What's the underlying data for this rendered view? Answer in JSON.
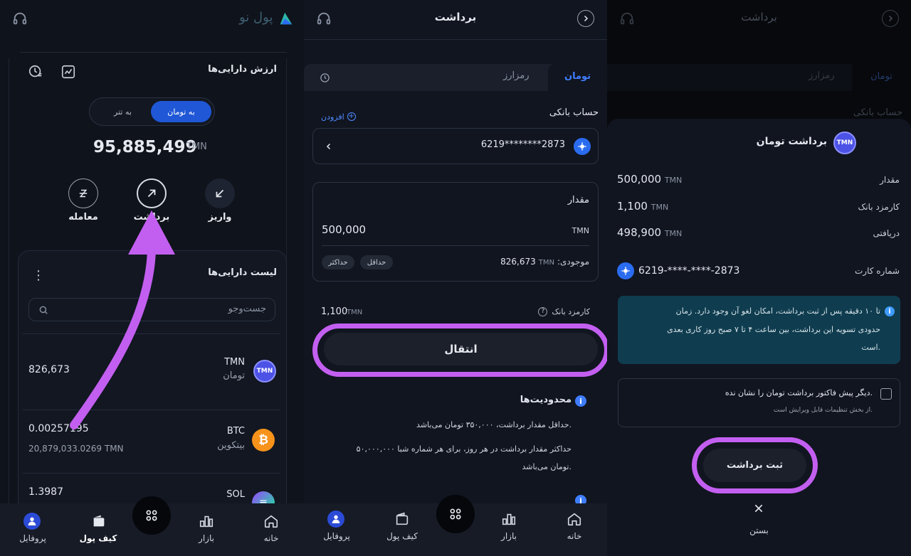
{
  "logo_text": "پول نو",
  "asset_value": {
    "title": "ارزش دارایی‌ها",
    "toggle_toman": "به تومان",
    "toggle_tether": "به تتر",
    "total": "95,885,499",
    "unit": "TMN"
  },
  "actions": {
    "deposit": "واریز",
    "withdraw": "برداشت",
    "trade": "معامله"
  },
  "asset_list": {
    "title": "لیست دارایی‌ها",
    "search_placeholder": "جست‌وجو",
    "items": [
      {
        "symbol": "TMN",
        "name": "تومان",
        "amount": "826,673",
        "sub": "",
        "icon": "TMN",
        "color": "#5b5ef0"
      },
      {
        "symbol": "BTC",
        "name": "بیتکوین",
        "amount": "0.00257195",
        "sub": "20,879,033.0269 TMN",
        "icon": "₿",
        "color": "#f7931a"
      },
      {
        "symbol": "SOL",
        "name": "",
        "amount": "1.3987",
        "sub": "",
        "icon": "≡",
        "color": "#14f195"
      }
    ]
  },
  "nav": {
    "home": "خانه",
    "market": "بازار",
    "wallet": "کیف پول",
    "profile": "پروفایل"
  },
  "withdraw": {
    "title": "برداشت",
    "tab_toman": "تومان",
    "tab_crypto": "رمزارز",
    "bank_account_label": "حساب بانکی",
    "add_label": "افزودن",
    "card_masked": "6219********2873",
    "amount_label": "مقدار",
    "amount_value": "500,000",
    "amount_unit": "TMN",
    "balance_label": "موجودی:",
    "balance_unit": "TMN",
    "balance_value": "826,673",
    "min_label": "حداقل",
    "max_label": "حداکثر",
    "fee_label": "کارمزد بانک",
    "fee_value": "1,100",
    "fee_unit": "TMN",
    "transfer_button": "انتقال",
    "limits_title": "محدودیت‌ها",
    "limit_min_text": "حداقل مقدار برداشت، ۳۵۰,۰۰۰ تومان می‌باشد.",
    "limit_max_line1": "حداکثر مقدار برداشت در هر روز، برای هر شماره شبا ۵۰,۰۰۰,۰۰۰",
    "limit_max_line2": "تومان می‌باشد."
  },
  "confirm": {
    "title": "برداشت تومان",
    "icon": "TMN",
    "amount_label": "مقدار",
    "amount_value": "500,000",
    "fee_label": "کارمزد بانک",
    "fee_value": "1,100",
    "received_label": "دریافتی",
    "received_value": "498,900",
    "unit": "TMN",
    "card_label": "شماره کارت",
    "card_value": "6219-****-****-2873",
    "info_line1": "تا ۱۰ دقیقه پس از ثبت برداشت، امکان لغو آن وجود دارد. زمان",
    "info_line2": "حدودی تسویه این برداشت، بین ساعت ۴ تا ۷ صبح روز کاری بعدی",
    "info_line3": "است.",
    "checkbox_label": "دیگر پیش فاکتور برداشت تومان را نشان نده.",
    "checkbox_hint": "از بخش تنظیمات قابل ویرایش است.",
    "submit_button": "ثبت برداشت",
    "close_label": "بستن"
  },
  "colors": {
    "accent": "#1f57d6",
    "highlight": "#c35ff0",
    "info_bg": "#0f3d4f"
  }
}
